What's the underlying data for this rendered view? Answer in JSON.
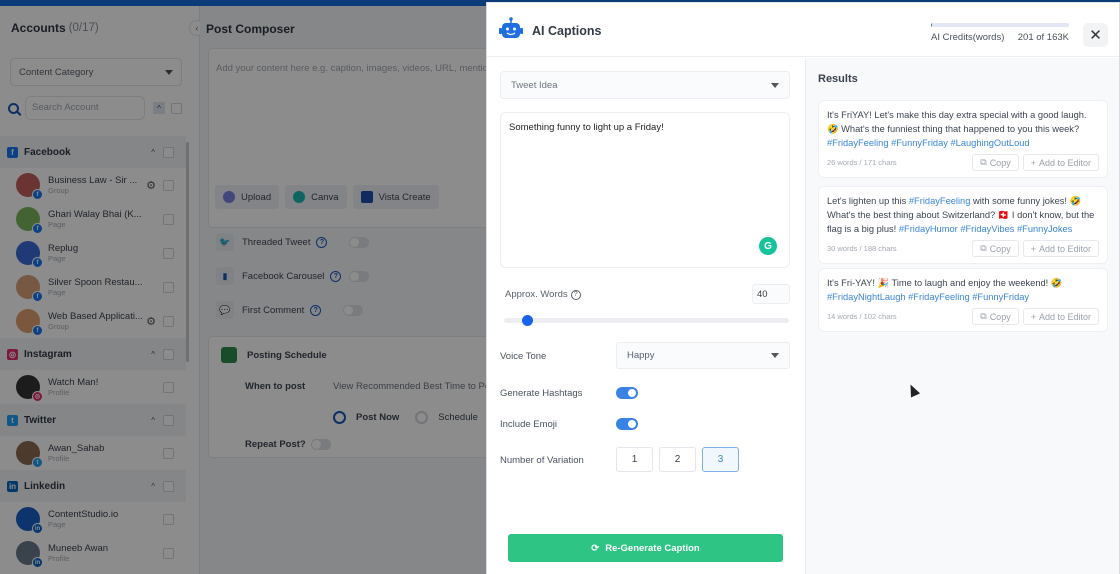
{
  "sidebar": {
    "title": "Accounts",
    "count": "(0/17)",
    "category_placeholder": "Content Category",
    "search_placeholder": "Search Account",
    "networks": [
      {
        "name": "Facebook",
        "icon": "facebook-icon",
        "color": "#1877f2",
        "glyph": "f",
        "accounts": [
          {
            "name": "Business Law - Sir ...",
            "type": "Group",
            "gear": true,
            "avatar_color": "#c0605a"
          },
          {
            "name": "Ghari Walay Bhai (K...",
            "type": "Page",
            "gear": false,
            "avatar_color": "#7ab55c"
          },
          {
            "name": "Replug",
            "type": "Page",
            "gear": false,
            "avatar_color": "#3a6ad8"
          },
          {
            "name": "Silver Spoon Restau...",
            "type": "Page",
            "gear": false,
            "avatar_color": "#d9a07a"
          },
          {
            "name": "Web Based Applicati...",
            "type": "Group",
            "gear": true,
            "avatar_color": "#e0a070"
          }
        ]
      },
      {
        "name": "Instagram",
        "icon": "instagram-icon",
        "color": "#e1306c",
        "glyph": "◎",
        "accounts": [
          {
            "name": "Watch Man!",
            "type": "Profile",
            "gear": false,
            "avatar_color": "#333"
          }
        ]
      },
      {
        "name": "Twitter",
        "icon": "twitter-icon",
        "color": "#1da1f2",
        "glyph": "t",
        "accounts": [
          {
            "name": "Awan_Sahab",
            "type": "Profile",
            "gear": false,
            "avatar_color": "#8a6a50"
          }
        ]
      },
      {
        "name": "Linkedin",
        "icon": "linkedin-icon",
        "color": "#0a66c2",
        "glyph": "in",
        "accounts": [
          {
            "name": "ContentStudio.io",
            "type": "Page",
            "gear": false,
            "avatar_color": "#1a5fc8"
          },
          {
            "name": "Muneeb Awan",
            "type": "Profile",
            "gear": false,
            "avatar_color": "#6a7a8a"
          }
        ]
      }
    ]
  },
  "composer": {
    "title": "Post Composer",
    "placeholder": "Add your content here e.g. caption, images, videos, URL, mention, e",
    "tools": [
      "Upload",
      "Canva",
      "Vista Create"
    ],
    "options": [
      {
        "label": "Threaded Tweet",
        "icon": "twitter-icon"
      },
      {
        "label": "Facebook Carousel",
        "icon": "carousel-icon"
      },
      {
        "label": "First Comment",
        "icon": "comment-icon"
      }
    ],
    "schedule": {
      "title": "Posting Schedule",
      "when_label": "When to post",
      "best_time_link": "View Recommended Best Time to Pos",
      "radio_options": [
        "Post Now",
        "Schedule"
      ],
      "selected": "Post Now",
      "repeat_label": "Repeat Post?"
    }
  },
  "modal": {
    "title": "AI Captions",
    "credits": {
      "label": "AI Credits(words)",
      "value": "201 of 163K",
      "used_fraction": 0.0012
    },
    "close_label": "✕",
    "type_select": "Tweet Idea",
    "idea_text": "Something funny to light up a Friday!",
    "approx_words_label": "Approx. Words",
    "approx_words_value": "40",
    "slider": {
      "min": 0,
      "max": 500,
      "value": 40
    },
    "voice_tone_label": "Voice Tone",
    "voice_tone_value": "Happy",
    "hashtags_label": "Generate Hashtags",
    "hashtags_on": true,
    "emoji_label": "Include Emoji",
    "emoji_on": true,
    "variation_label": "Number of Variation",
    "variation_options": [
      "1",
      "2",
      "3"
    ],
    "variation_selected": "3",
    "regenerate_label": "Re-Generate Caption",
    "results_title": "Results",
    "copy_label": "Copy",
    "add_label": "Add to Editor",
    "results": [
      {
        "segments": [
          {
            "t": "It's FriYAY! Let's make this day extra special with a good laugh. 🤣 What's the funniest thing that happened to you this week? ",
            "tag": false
          },
          {
            "t": "#FridayFeeling #FunnyFriday #LaughingOutLoud",
            "tag": true
          }
        ],
        "meta": "26 words / 171 chars"
      },
      {
        "segments": [
          {
            "t": "Let's lighten up this ",
            "tag": false
          },
          {
            "t": "#FridayFeeling",
            "tag": true
          },
          {
            "t": " with some funny jokes! 🤣 What's the best thing about Switzerland? 🇨🇭 I don't know, but the flag is a big plus! ",
            "tag": false
          },
          {
            "t": "#FridayHumor #FridayVibes #FunnyJokes",
            "tag": true
          }
        ],
        "meta": "30 words / 188 chars"
      },
      {
        "segments": [
          {
            "t": "It's Fri-YAY! 🎉 Time to laugh and enjoy the weekend! 🤣 ",
            "tag": false
          },
          {
            "t": "#FridayNightLaugh #FridayFeeling #FunnyFriday",
            "tag": true
          }
        ],
        "meta": "14 words / 102 chars"
      }
    ]
  },
  "colors": {
    "accent": "#1764e8",
    "success": "#2ec483",
    "hashtag": "#3a86d8",
    "topbar": "#0b3b78"
  }
}
